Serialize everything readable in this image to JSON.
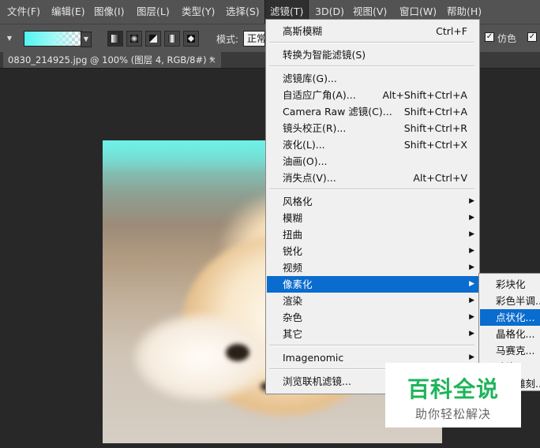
{
  "menubar": {
    "items": [
      {
        "label": "文件(F)"
      },
      {
        "label": "编辑(E)"
      },
      {
        "label": "图像(I)"
      },
      {
        "label": "图层(L)"
      },
      {
        "label": "类型(Y)"
      },
      {
        "label": "选择(S)"
      },
      {
        "label": "滤镜(T)"
      },
      {
        "label": "3D(D)"
      },
      {
        "label": "视图(V)"
      },
      {
        "label": "窗口(W)"
      },
      {
        "label": "帮助(H)"
      }
    ]
  },
  "options_bar": {
    "mode_label": "模式:",
    "mode_value": "正常",
    "dither_label": "仿色",
    "gradient_colors": [
      "#4ff5f2",
      "#9ff8f6"
    ]
  },
  "document_tab": {
    "title": "0830_214925.jpg @ 100% (图层 4, RGB/8#) *",
    "close": "×"
  },
  "filter_menu": {
    "items": [
      {
        "label": "高斯模糊",
        "shortcut": "Ctrl+F"
      },
      {
        "label": "转换为智能滤镜(S)",
        "shortcut": ""
      },
      {
        "label": "滤镜库(G)...",
        "shortcut": ""
      },
      {
        "label": "自适应广角(A)...",
        "shortcut": "Alt+Shift+Ctrl+A"
      },
      {
        "label": "Camera Raw 滤镜(C)...",
        "shortcut": "Shift+Ctrl+A"
      },
      {
        "label": "镜头校正(R)...",
        "shortcut": "Shift+Ctrl+R"
      },
      {
        "label": "液化(L)...",
        "shortcut": "Shift+Ctrl+X"
      },
      {
        "label": "油画(O)...",
        "shortcut": ""
      },
      {
        "label": "消失点(V)...",
        "shortcut": "Alt+Ctrl+V"
      },
      {
        "label": "风格化",
        "shortcut": ""
      },
      {
        "label": "模糊",
        "shortcut": ""
      },
      {
        "label": "扭曲",
        "shortcut": ""
      },
      {
        "label": "锐化",
        "shortcut": ""
      },
      {
        "label": "视频",
        "shortcut": ""
      },
      {
        "label": "像素化",
        "shortcut": ""
      },
      {
        "label": "渲染",
        "shortcut": ""
      },
      {
        "label": "杂色",
        "shortcut": ""
      },
      {
        "label": "其它",
        "shortcut": ""
      },
      {
        "label": "Imagenomic",
        "shortcut": ""
      },
      {
        "label": "浏览联机滤镜...",
        "shortcut": ""
      }
    ]
  },
  "pixelate_submenu": {
    "items": [
      {
        "label": "彩块化"
      },
      {
        "label": "彩色半调..."
      },
      {
        "label": "点状化..."
      },
      {
        "label": "晶格化..."
      },
      {
        "label": "马赛克..."
      },
      {
        "label": "碎片"
      },
      {
        "label": "铜版雕刻..."
      }
    ]
  },
  "watermark": {
    "title": "百科全说",
    "subtitle": "助你轻松解决"
  },
  "colors": {
    "menu_highlight": "#0a6cce",
    "menubar_bg": "#535353",
    "workspace_bg": "#282828",
    "watermark_green": "#1fb45a"
  }
}
